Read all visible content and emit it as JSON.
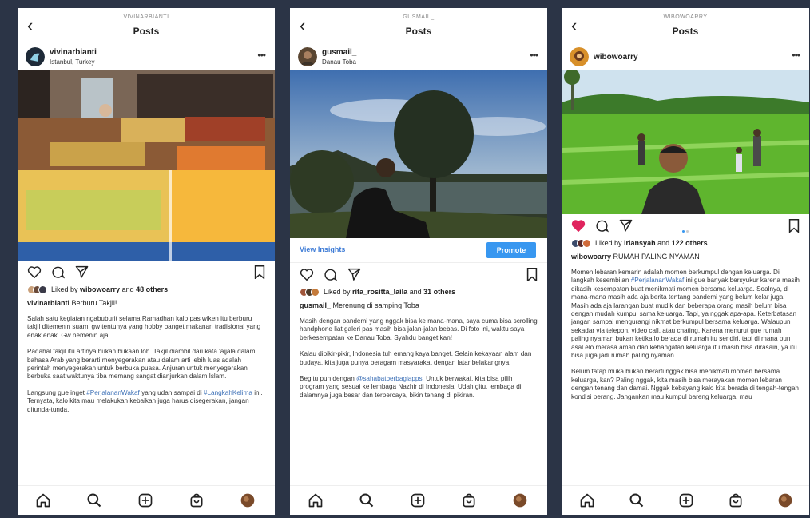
{
  "screens": [
    {
      "header_user": "VIVINARBIANTI",
      "header_title": "Posts",
      "username": "vivinarbianti",
      "location": "Istanbul, Turkey",
      "liked_by": "Liked by",
      "liker": "wibowoarry",
      "and": "and",
      "others": "48 others",
      "caption_user": "vivinarbianti",
      "caption_text": "Berburu Takjil!",
      "paragraphs": [
        "Salah satu kegiatan ngabuburit selama Ramadhan kalo pas wiken itu berburu takjil ditemenin suami gw tentunya yang hobby banget makanan tradisional yang enak enak. Gw nemenin aja.",
        "Padahal takjil itu artinya bukan bukaan loh.  Takjil diambil dari kata 'ajjala dalam bahasa Arab yang berarti menyegerakan atau dalam arti lebih luas adalah perintah menyegerakan untuk berbuka puasa. Anjuran untuk menyegerakan berbuka saat waktunya tiba memang sangat dianjurkan dalam Islam."
      ],
      "para3": {
        "a": "Langsung gue inget ",
        "tag1": "#PerjalananWakaf",
        "b": " yang udah sampai di ",
        "tag2": "#LangkahKelima",
        "c": " ini. Ternyata, kalo kita mau melakukan kebaikan juga harus disegerakan, jangan ditunda-tunda."
      }
    },
    {
      "header_user": "GUSMAIL_",
      "header_title": "Posts",
      "username": "gusmail_",
      "location": "Danau Toba",
      "view_insights": "View Insights",
      "promote": "Promote",
      "liked_by": "Liked by",
      "liker": "rita_rositta_laila",
      "and": "and",
      "others": "31 others",
      "caption_user": "gusmail_",
      "caption_text": "Merenung di samping Toba",
      "paragraphs": [
        "Masih dengan pandemi yang nggak bisa ke mana-mana, saya cuma bisa scrolling handphone liat galeri pas masih bisa jalan-jalan bebas. Di foto ini, waktu saya berkesempatan ke Danau Toba. Syahdu banget kan!",
        "Kalau dipikir-pikir, Indonesia tuh emang kaya banget. Selain kekayaan alam dan budaya, kita juga punya beragam masyarakat dengan latar belakangnya."
      ],
      "para3": {
        "a": "Begitu pun dengan ",
        "tag1": "@sahabatberbagiapps",
        "b": ". Untuk berwakaf, kita bisa pilih program yang sesuai ke lembaga Nazhir di Indonesia. Udah gitu, lembaga di dalamnya juga besar dan terpercaya, bikin tenang di pikiran."
      }
    },
    {
      "header_user": "WIBOWOARRY",
      "header_title": "Posts",
      "username": "wibowoarry",
      "liked_by": "Liked by",
      "liker": "irlansyah",
      "and": "and",
      "others": "122 others",
      "caption_user": "wibowoarry",
      "caption_text": "RUMAH PALING NYAMAN",
      "para1": {
        "a": "Momen lebaran kemarin adalah momen berkumpul dengan keluarga. Di langkah kesembilan ",
        "tag1": "#PerjalananWakaf",
        "b": " ini gue banyak bersyukur karena masih dikasih kesempatan buat menikmati momen bersama keluarga. Soalnya, di mana-mana masih ada aja berita tentang pandemi yang belum kelar juga. Masih ada aja larangan buat mudik dan beberapa orang masih belum bisa dengan mudah kumpul sama keluarga. Tapi, ya nggak apa-apa. Keterbatasan jangan sampai mengurangi nikmat berkumpul bersama keluarga. Walaupun sekadar via telepon, video call, atau chating. Karena menurut gue rumah paling nyaman bukan ketika lo berada di rumah itu sendiri, tapi di mana pun asal elo merasa aman dan kehangatan keluarga itu masih bisa dirasain, ya itu bisa juga jadi rumah paling nyaman."
      },
      "para2": "Belum tatap muka bukan berarti nggak bisa menikmati momen bersama keluarga, kan? Paling nggak, kita masih bisa merayakan momen lebaran dengan tenang dan damai. Nggak kebayang kalo kita berada di tengah-tengah kondisi perang. Jangankan mau kumpul bareng keluarga, mau"
    }
  ],
  "icons": [
    "back-icon",
    "more-icon",
    "heart-icon",
    "comment-icon",
    "share-icon",
    "bookmark-icon",
    "home-icon",
    "search-icon",
    "add-icon",
    "shop-icon",
    "profile-icon"
  ],
  "colors": {
    "background": "#2b3446",
    "link": "#3b6fb6",
    "promote": "#3897f0",
    "liked_heart": "#e0245e"
  }
}
